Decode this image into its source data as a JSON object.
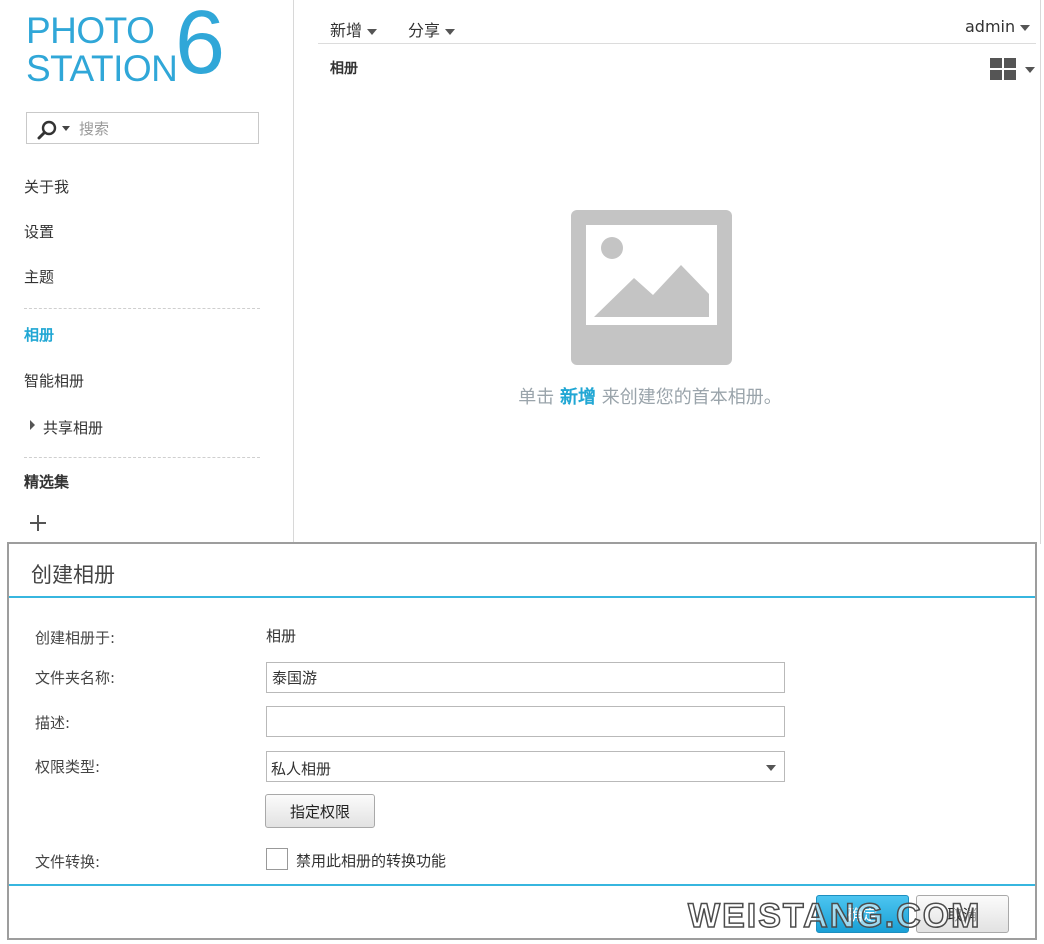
{
  "brand": {
    "logo_line1": "PHOTO",
    "logo_line2": "STATION",
    "logo_version": "6",
    "color": "#30a7d8"
  },
  "accent_color": "#21a7d4",
  "search": {
    "placeholder": "搜索",
    "icon": "search-icon"
  },
  "sidebar": {
    "items": [
      {
        "label": "关于我"
      },
      {
        "label": "设置"
      },
      {
        "label": "主题"
      },
      {
        "label": "相册",
        "active": true
      },
      {
        "label": "智能相册"
      },
      {
        "label": "共享相册",
        "expandable": true
      }
    ],
    "collections_heading": "精选集",
    "add_icon": "plus-icon"
  },
  "toolbar": {
    "new_label": "新增",
    "share_label": "分享",
    "user_label": "admin"
  },
  "main": {
    "title": "相册",
    "empty_message": {
      "before": "单击",
      "link": "新增",
      "after": "来创建您的首本相册。"
    },
    "view_icon": "grid-view-icon",
    "placeholder_icon": "image-placeholder-icon"
  },
  "dialog": {
    "title": "创建相册",
    "fields": {
      "location": {
        "label": "创建相册于:",
        "value": "相册"
      },
      "folder_name": {
        "label": "文件夹名称:",
        "value": "泰国游"
      },
      "description": {
        "label": "描述:",
        "value": ""
      },
      "permission": {
        "label": "权限类型:",
        "value": "私人相册",
        "button_label": "指定权限"
      },
      "conversion": {
        "label": "文件转换:",
        "checkbox_label": "禁用此相册的转换功能",
        "checked": false
      }
    },
    "ok_label": "确定",
    "cancel_label": "取消"
  },
  "watermark": "WEISTANG.COM"
}
